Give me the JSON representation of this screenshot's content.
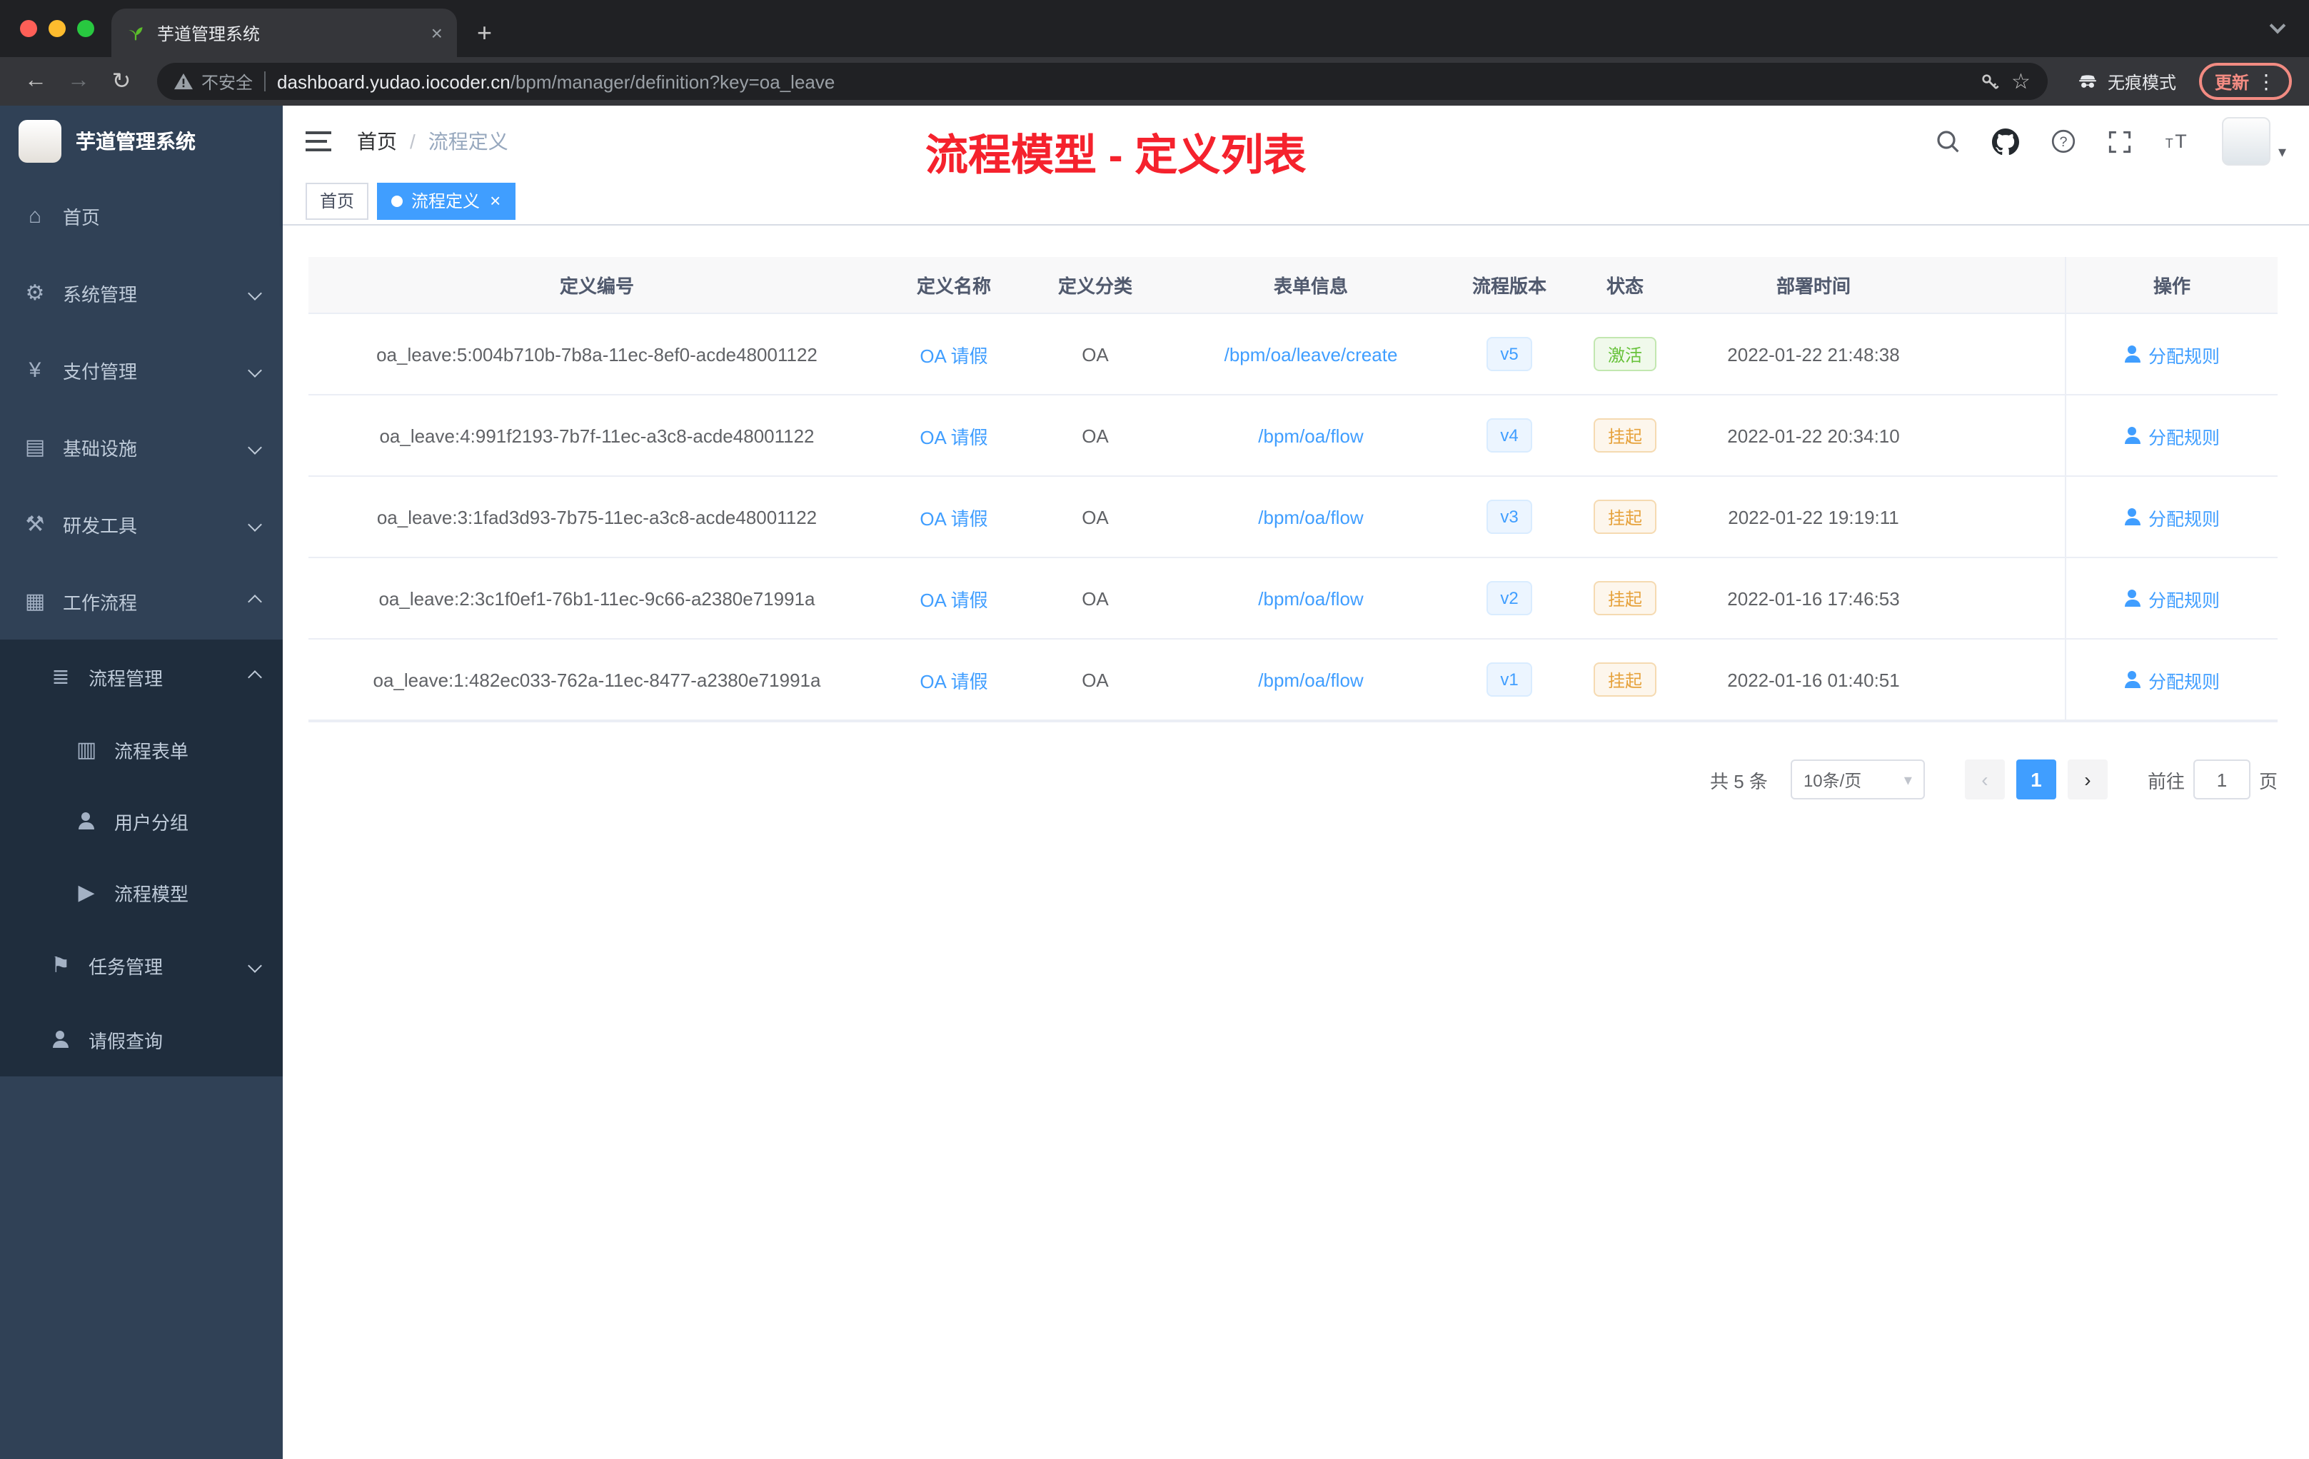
{
  "browser": {
    "tab": {
      "title": "芋道管理系统"
    },
    "address": {
      "security_label": "不安全",
      "host": "dashboard.yudao.iocoder.cn",
      "path": "/bpm/manager/definition?key=oa_leave"
    },
    "incognito_label": "无痕模式",
    "update_label": "更新"
  },
  "icons": {
    "back-icon": "←",
    "forward-icon": "→",
    "reload-icon": "↻",
    "star-icon": "☆",
    "kebab-icon": "⋮",
    "plus-icon": "+",
    "close-icon": "×",
    "caret-down-icon": "▾",
    "home-icon": "⌂",
    "gear-icon": "⚙",
    "yen-icon": "¥",
    "infra-icon": "▤",
    "tools-icon": "⚒",
    "workflow-icon": "▦",
    "list-icon": "≣",
    "form-icon": "▥",
    "users-icon": "@person",
    "send-icon": "▶",
    "task-icon": "⚑",
    "user-icon": "@person"
  },
  "sidebar": {
    "logo_title": "芋道管理系统",
    "items": [
      {
        "key": "home",
        "label": "首页",
        "icon": "home-icon",
        "level": 1
      },
      {
        "key": "system",
        "label": "系统管理",
        "icon": "gear-icon",
        "level": 1,
        "chevron": "down"
      },
      {
        "key": "payment",
        "label": "支付管理",
        "icon": "yen-icon",
        "level": 1,
        "chevron": "down"
      },
      {
        "key": "infrastructure",
        "label": "基础设施",
        "icon": "infra-icon",
        "level": 1,
        "chevron": "down"
      },
      {
        "key": "dev-tools",
        "label": "研发工具",
        "icon": "tools-icon",
        "level": 1,
        "chevron": "down"
      },
      {
        "key": "workflow",
        "label": "工作流程",
        "icon": "workflow-icon",
        "level": 1,
        "chevron": "up"
      },
      {
        "key": "process-mgmt",
        "label": "流程管理",
        "icon": "list-icon",
        "level": 2,
        "chevron": "up"
      },
      {
        "key": "process-form",
        "label": "流程表单",
        "icon": "form-icon",
        "level": 3
      },
      {
        "key": "user-group",
        "label": "用户分组",
        "icon": "users-icon",
        "level": 3
      },
      {
        "key": "process-model",
        "label": "流程模型",
        "icon": "send-icon",
        "level": 3
      },
      {
        "key": "task-mgmt",
        "label": "任务管理",
        "icon": "task-icon",
        "level": 2,
        "chevron": "down"
      },
      {
        "key": "leave-query",
        "label": "请假查询",
        "icon": "user-icon",
        "level": 2
      }
    ]
  },
  "header": {
    "breadcrumb": [
      "首页",
      "流程定义"
    ],
    "breadcrumb_separator": "/",
    "overlay_title": "流程模型 - 定义列表"
  },
  "tags_view": [
    {
      "key": "home",
      "label": "首页",
      "active": false,
      "closable": false
    },
    {
      "key": "bpm-definition",
      "label": "流程定义",
      "active": true,
      "closable": true
    }
  ],
  "table": {
    "columns": [
      "定义编号",
      "定义名称",
      "定义分类",
      "表单信息",
      "流程版本",
      "状态",
      "部署时间",
      "操作"
    ],
    "rows": [
      {
        "id": "oa_leave:5:004b710b-7b8a-11ec-8ef0-acde48001122",
        "name": "OA 请假",
        "category": "OA",
        "form": "/bpm/oa/leave/create",
        "version": "v5",
        "status": "激活",
        "status_type": "success",
        "deploy_time": "2022-01-22 21:48:38",
        "action": "分配规则"
      },
      {
        "id": "oa_leave:4:991f2193-7b7f-11ec-a3c8-acde48001122",
        "name": "OA 请假",
        "category": "OA",
        "form": "/bpm/oa/flow",
        "version": "v4",
        "status": "挂起",
        "status_type": "warning",
        "deploy_time": "2022-01-22 20:34:10",
        "action": "分配规则"
      },
      {
        "id": "oa_leave:3:1fad3d93-7b75-11ec-a3c8-acde48001122",
        "name": "OA 请假",
        "category": "OA",
        "form": "/bpm/oa/flow",
        "version": "v3",
        "status": "挂起",
        "status_type": "warning",
        "deploy_time": "2022-01-22 19:19:11",
        "action": "分配规则"
      },
      {
        "id": "oa_leave:2:3c1f0ef1-76b1-11ec-9c66-a2380e71991a",
        "name": "OA 请假",
        "category": "OA",
        "form": "/bpm/oa/flow",
        "version": "v2",
        "status": "挂起",
        "status_type": "warning",
        "deploy_time": "2022-01-16 17:46:53",
        "action": "分配规则"
      },
      {
        "id": "oa_leave:1:482ec033-762a-11ec-8477-a2380e71991a",
        "name": "OA 请假",
        "category": "OA",
        "form": "/bpm/oa/flow",
        "version": "v1",
        "status": "挂起",
        "status_type": "warning",
        "deploy_time": "2022-01-16 01:40:51",
        "action": "分配规则"
      }
    ]
  },
  "pagination": {
    "total": "共 5 条",
    "page_size": "10条/页",
    "prev": "‹",
    "current_page": "1",
    "next": "›",
    "goto_prefix": "前往",
    "goto_value": "1",
    "goto_suffix": "页"
  },
  "colors": {
    "primary": "#409eff",
    "success": "#67c23a",
    "warning": "#e6a23c",
    "sidebar_bg": "#304156",
    "submenu_bg": "#1f2d3d",
    "annotation_red": "#f5222d"
  }
}
